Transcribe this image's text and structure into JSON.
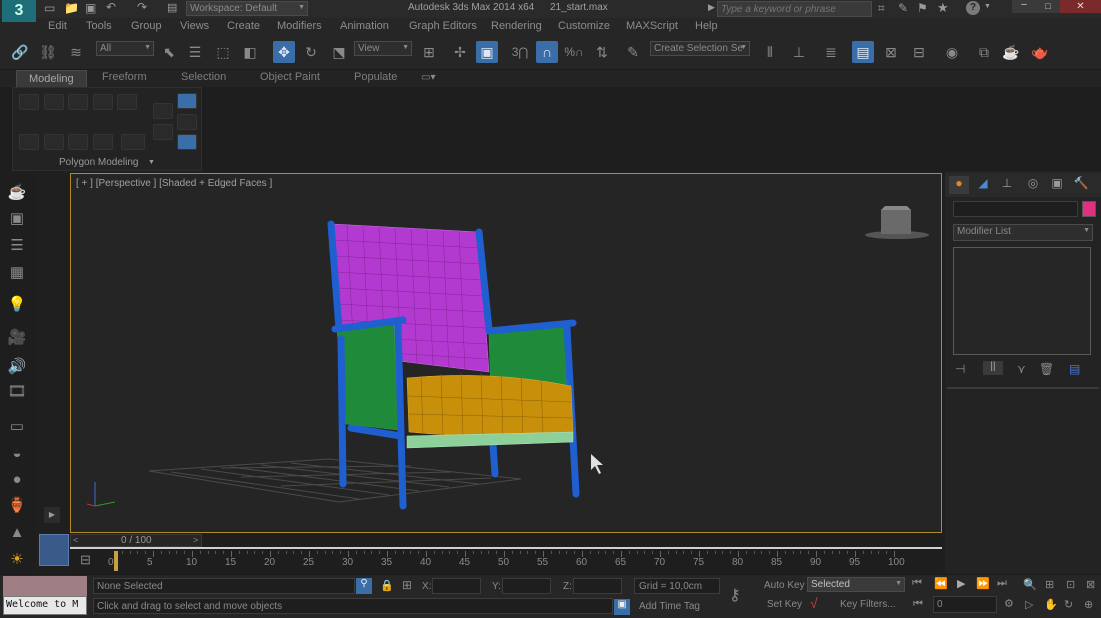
{
  "title": {
    "workspace": "Workspace: Default",
    "app_title": "Autodesk 3ds Max  2014 x64",
    "file_name": "21_start.max",
    "search_placeholder": "Type a keyword or phrase"
  },
  "menu": [
    "Edit",
    "Tools",
    "Group",
    "Views",
    "Create",
    "Modifiers",
    "Animation",
    "Graph Editors",
    "Rendering",
    "Customize",
    "MAXScript",
    "Help"
  ],
  "toolbar": {
    "selection_filter": "All",
    "reference_coord": "View",
    "snap_3": "3",
    "snap_2_5": "2",
    "percent_label": "%",
    "named_selection": "Create Selection Se"
  },
  "ribbon": {
    "tabs": [
      "Modeling",
      "Freeform",
      "Selection",
      "Object Paint",
      "Populate"
    ],
    "panel_label": "Polygon Modeling"
  },
  "viewport": {
    "label": "[ + ] [Perspective ] [Shaded + Edged Faces ]"
  },
  "command_panel": {
    "modifier_list": "Modifier List",
    "color_swatch": "#e0307f"
  },
  "timeline": {
    "frame_counter": "0 / 100",
    "ticks": [
      "0",
      "5",
      "10",
      "15",
      "20",
      "25",
      "30",
      "35",
      "40",
      "45",
      "50",
      "55",
      "60",
      "65",
      "70",
      "75",
      "80",
      "85",
      "90",
      "95",
      "100"
    ]
  },
  "status": {
    "selection": "None Selected",
    "prompt": "Click and drag to select and move objects",
    "listener": "Welcome to M",
    "x_label": "X:",
    "y_label": "Y:",
    "z_label": "Z:",
    "grid": "Grid = 10,0cm",
    "add_time_tag": "Add Time Tag",
    "auto_key": "Auto Key",
    "set_key": "Set Key",
    "key_mode": "Selected",
    "key_filters": "Key Filters...",
    "current_frame": "0"
  },
  "colors": {
    "viewport_border": "#b38a2a",
    "accent_blue": "#3a6ea8",
    "chair_frame": "#1f5fd0",
    "chair_back": "#b33ad0",
    "chair_arms": "#1f8a3a",
    "chair_seat": "#c8900a",
    "chair_rail": "#8ed09a"
  }
}
